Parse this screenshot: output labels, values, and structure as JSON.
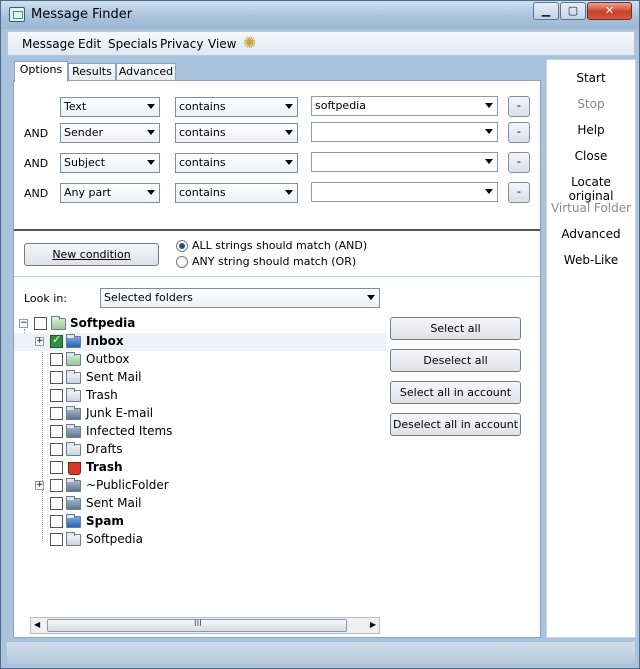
{
  "window": {
    "title": "Message Finder",
    "min": "▁",
    "max": "▢",
    "close": "✕"
  },
  "menu": [
    "Message",
    "Edit",
    "Specials",
    "Privacy",
    "View"
  ],
  "tabs": [
    "Options",
    "Results",
    "Advanced"
  ],
  "conditions": [
    {
      "join": "",
      "field": "Text",
      "op": "contains",
      "value": "softpedia",
      "remove": "-"
    },
    {
      "join": "AND",
      "field": "Sender",
      "op": "contains",
      "value": "",
      "remove": "-"
    },
    {
      "join": "AND",
      "field": "Subject",
      "op": "contains",
      "value": "",
      "remove": "-"
    },
    {
      "join": "AND",
      "field": "Any part",
      "op": "contains",
      "value": "",
      "remove": "-"
    }
  ],
  "new_condition": "New condition",
  "match": {
    "all": "ALL strings should match (AND)",
    "any": "ANY string should match (OR)",
    "selected": "all"
  },
  "look_in": {
    "label": "Look in:",
    "value": "Selected folders"
  },
  "tree": [
    {
      "label": "Softpedia",
      "bold": true,
      "checked": false,
      "icon": "account-icon"
    },
    {
      "label": "Inbox",
      "bold": true,
      "checked": true,
      "icon": "inbox-folder-icon"
    },
    {
      "label": "Outbox",
      "bold": false,
      "checked": false,
      "icon": "outbox-folder-icon"
    },
    {
      "label": "Sent Mail",
      "bold": false,
      "checked": false,
      "icon": "folder-icon"
    },
    {
      "label": "Trash",
      "bold": false,
      "checked": false,
      "icon": "folder-icon"
    },
    {
      "label": "Junk E-mail",
      "bold": false,
      "checked": false,
      "icon": "folder-icon"
    },
    {
      "label": "Infected Items",
      "bold": false,
      "checked": false,
      "icon": "folder-icon"
    },
    {
      "label": "Drafts",
      "bold": false,
      "checked": false,
      "icon": "folder-icon"
    },
    {
      "label": "Trash",
      "bold": true,
      "checked": false,
      "icon": "trash-icon"
    },
    {
      "label": "~PublicFolder",
      "bold": false,
      "checked": false,
      "icon": "folder-icon"
    },
    {
      "label": "Sent Mail",
      "bold": false,
      "checked": false,
      "icon": "sent-folder-icon"
    },
    {
      "label": "Spam",
      "bold": true,
      "checked": false,
      "icon": "spam-folder-icon"
    },
    {
      "label": "Softpedia",
      "bold": false,
      "checked": false,
      "icon": "folder-icon"
    }
  ],
  "select_buttons": [
    "Select all",
    "Deselect all",
    "Select all in account",
    "Deselect all in account"
  ],
  "scroll_grip": "III",
  "sidebar": [
    {
      "label": "Start",
      "enabled": true
    },
    {
      "label": "Stop",
      "enabled": false
    },
    {
      "label": "Help",
      "enabled": true
    },
    {
      "label": "Close",
      "enabled": true
    },
    {
      "label": "Locate original",
      "enabled": true
    },
    {
      "label": "Virtual Folder",
      "enabled": false
    },
    {
      "label": "Advanced",
      "enabled": true
    },
    {
      "label": "Web-Like",
      "enabled": true
    }
  ]
}
